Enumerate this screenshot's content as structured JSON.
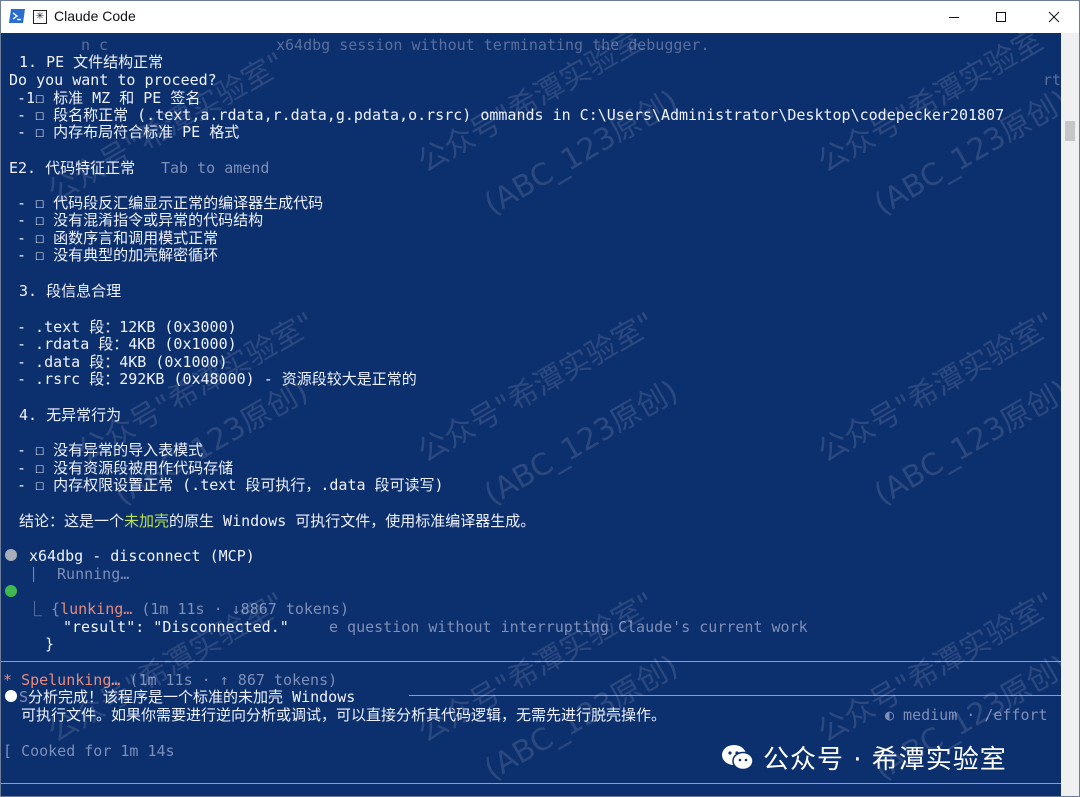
{
  "window": {
    "title": "Claude Code",
    "minimize_glyph": "—",
    "maximize_glyph": "☐",
    "close_glyph": "✕"
  },
  "terminal": {
    "top_fragment_left": "n c",
    "top_fragment_right": "x64dbg session without terminating the debugger.",
    "section1_title": "1. PE 文件结构正常",
    "proceed_prompt": "Do you want to proceed?",
    "proceed_right_fragment": "rt",
    "s1_items": [
      "-1☐ 标准 MZ 和 PE 签名",
      "- ☐ 段名称正常 (.text,a.rdata,r.data,g.pdata,o.rsrc) ommands in C:\\Users\\Administrator\\Desktop\\codepecker201807",
      "- ☐ 内存布局符合标准 PE 格式"
    ],
    "section2_title": "E2. 代码特征正常",
    "tab_hint": "Tab to amend",
    "s2_items": [
      "- ☐ 代码段反汇编显示正常的编译器生成代码",
      "- ☐ 没有混淆指令或异常的代码结构",
      "- ☐ 函数序言和调用模式正常",
      "- ☐ 没有典型的加壳解密循环"
    ],
    "section3_title": "3. 段信息合理",
    "s3_items": [
      "- .text 段：12KB (0x3000)",
      "- .rdata 段：4KB (0x1000)",
      "- .data 段：4KB (0x1000)",
      "- .rsrc 段：292KB (0x48000) - 资源段较大是正常的"
    ],
    "section4_title": "4. 无异常行为",
    "s4_items": [
      "- ☐ 没有异常的导入表模式",
      "- ☐ 没有资源段被用作代码存储",
      "- ☐ 内存权限设置正常 (.text 段可执行，.data 段可读写)"
    ],
    "conclusion_prefix": "结论：这是一个",
    "conclusion_highlight": "未加壳",
    "conclusion_suffix": "的原生 Windows 可执行文件，使用标准编译器生成。",
    "tool_call": "x64dbg - disconnect (MCP)",
    "running": "⎸ Running…",
    "result_l1_prefix": "⎿ {",
    "result_l1_word": "lunking…",
    "result_l1_stats": " (1m 11s · ↓8867 tokens)",
    "result_l2": "\"result\": \"Disconnected.\"",
    "result_l2_right": "e question without interrupting Claude's current work",
    "result_l3": "}",
    "spinner_glyph": "*",
    "spelunking_word": "Spelunking…",
    "spelunking_stats": " (1m 11s · ↑ 867 tokens)",
    "answer_l1_prefix": "S",
    "answer_l1": "分析完成！该程序是一个标准的未加壳 Windows",
    "answer_l2": "可执行文件。如果你需要进行逆向分析或调试，可以直接分析其代码逻辑，无需先进行脱壳操作。",
    "effort_text": "◐ medium · /effort",
    "cooked_prefix": "[",
    "cooked": "Cooked for 1m 14s"
  },
  "watermarks": [
    "公众号\"希潭实验室\"",
    "(ABC_123原创)"
  ],
  "wechat": {
    "label": "公众号 · 希潭实验室"
  },
  "colors": {
    "terminal_bg": "#0c2f6e",
    "highlight_green": "#b9e04a",
    "spinner_salmon": "#e88a7a",
    "dot_gray": "#a8adb8",
    "dot_green": "#3fb950"
  }
}
